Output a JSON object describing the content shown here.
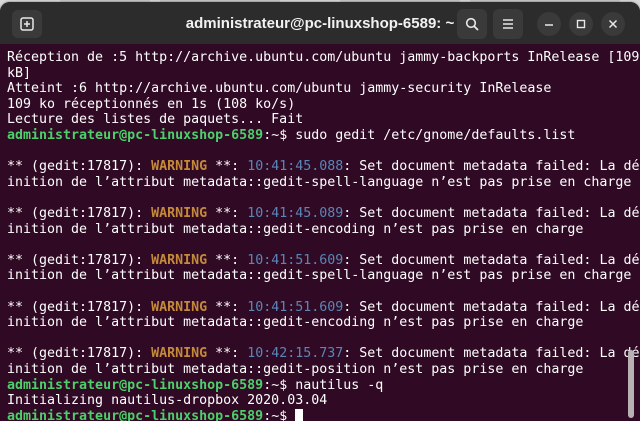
{
  "window": {
    "title": "administrateur@pc-linuxshop-6589: ~"
  },
  "terminal": {
    "lines": [
      {
        "segments": [
          {
            "t": "Réception de :5 http://archive.ubuntu.com/ubuntu jammy-backports InRelease [109",
            "c": "plain"
          }
        ]
      },
      {
        "segments": [
          {
            "t": "kB]",
            "c": "plain"
          }
        ]
      },
      {
        "segments": [
          {
            "t": "Atteint :6 http://archive.ubuntu.com/ubuntu jammy-security InRelease",
            "c": "plain"
          }
        ]
      },
      {
        "segments": [
          {
            "t": "109 ko réceptionnés en 1s (108 ko/s)",
            "c": "plain"
          }
        ]
      },
      {
        "segments": [
          {
            "t": "Lecture des listes de paquets... Fait",
            "c": "plain"
          }
        ]
      },
      {
        "segments": [
          {
            "t": "administrateur@pc-linuxshop-6589",
            "c": "prompt"
          },
          {
            "t": ":~$ sudo gedit /etc/gnome/defaults.list",
            "c": "plain"
          }
        ]
      },
      {
        "segments": [
          {
            "t": "",
            "c": "plain"
          }
        ]
      },
      {
        "segments": [
          {
            "t": "** (gedit:17817): ",
            "c": "plain"
          },
          {
            "t": "WARNING",
            "c": "warn"
          },
          {
            "t": " **: ",
            "c": "plain"
          },
          {
            "t": "10:41:45.088",
            "c": "time"
          },
          {
            "t": ": Set document metadata failed: La déf",
            "c": "plain"
          }
        ]
      },
      {
        "segments": [
          {
            "t": "inition de l’attribut metadata::gedit-spell-language n’est pas prise en charge",
            "c": "plain"
          }
        ]
      },
      {
        "segments": [
          {
            "t": "",
            "c": "plain"
          }
        ]
      },
      {
        "segments": [
          {
            "t": "** (gedit:17817): ",
            "c": "plain"
          },
          {
            "t": "WARNING",
            "c": "warn"
          },
          {
            "t": " **: ",
            "c": "plain"
          },
          {
            "t": "10:41:45.089",
            "c": "time"
          },
          {
            "t": ": Set document metadata failed: La déf",
            "c": "plain"
          }
        ]
      },
      {
        "segments": [
          {
            "t": "inition de l’attribut metadata::gedit-encoding n’est pas prise en charge",
            "c": "plain"
          }
        ]
      },
      {
        "segments": [
          {
            "t": "",
            "c": "plain"
          }
        ]
      },
      {
        "segments": [
          {
            "t": "** (gedit:17817): ",
            "c": "plain"
          },
          {
            "t": "WARNING",
            "c": "warn"
          },
          {
            "t": " **: ",
            "c": "plain"
          },
          {
            "t": "10:41:51.609",
            "c": "time"
          },
          {
            "t": ": Set document metadata failed: La déf",
            "c": "plain"
          }
        ]
      },
      {
        "segments": [
          {
            "t": "inition de l’attribut metadata::gedit-spell-language n’est pas prise en charge",
            "c": "plain"
          }
        ]
      },
      {
        "segments": [
          {
            "t": "",
            "c": "plain"
          }
        ]
      },
      {
        "segments": [
          {
            "t": "** (gedit:17817): ",
            "c": "plain"
          },
          {
            "t": "WARNING",
            "c": "warn"
          },
          {
            "t": " **: ",
            "c": "plain"
          },
          {
            "t": "10:41:51.609",
            "c": "time"
          },
          {
            "t": ": Set document metadata failed: La déf",
            "c": "plain"
          }
        ]
      },
      {
        "segments": [
          {
            "t": "inition de l’attribut metadata::gedit-encoding n’est pas prise en charge",
            "c": "plain"
          }
        ]
      },
      {
        "segments": [
          {
            "t": "",
            "c": "plain"
          }
        ]
      },
      {
        "segments": [
          {
            "t": "** (gedit:17817): ",
            "c": "plain"
          },
          {
            "t": "WARNING",
            "c": "warn"
          },
          {
            "t": " **: ",
            "c": "plain"
          },
          {
            "t": "10:42:15.737",
            "c": "time"
          },
          {
            "t": ": Set document metadata failed: La déf",
            "c": "plain"
          }
        ]
      },
      {
        "segments": [
          {
            "t": "inition de l’attribut metadata::gedit-position n’est pas prise en charge",
            "c": "plain"
          }
        ]
      },
      {
        "segments": [
          {
            "t": "administrateur@pc-linuxshop-6589",
            "c": "prompt"
          },
          {
            "t": ":~$ nautilus -q",
            "c": "plain"
          }
        ]
      },
      {
        "segments": [
          {
            "t": "Initializing nautilus-dropbox 2020.03.04",
            "c": "plain"
          }
        ]
      },
      {
        "segments": [
          {
            "t": "administrateur@pc-linuxshop-6589",
            "c": "prompt"
          },
          {
            "t": ":~$ ",
            "c": "plain"
          }
        ],
        "cursor": true
      }
    ]
  },
  "icons": {
    "new_tab": "new-tab-icon",
    "search": "search-icon",
    "menu": "hamburger-menu-icon",
    "minimize": "minimize-icon",
    "maximize": "maximize-icon",
    "close": "close-icon"
  },
  "colors": {
    "terminal_bg": "#300a24",
    "titlebar_bg": "#2c2c2c",
    "prompt": "#4bd06a",
    "warning": "#c48a3a",
    "timestamp": "#5a86b8",
    "text": "#ffffff"
  }
}
